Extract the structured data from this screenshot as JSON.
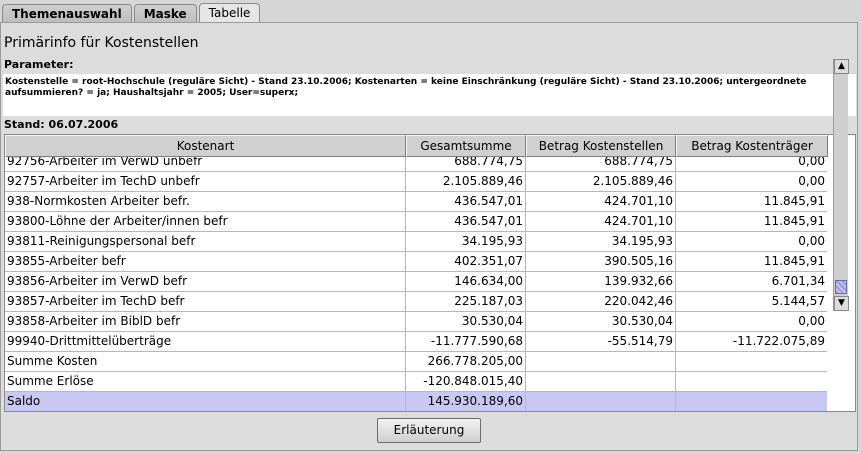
{
  "tabs": [
    {
      "label": "Themenauswahl"
    },
    {
      "label": "Maske"
    },
    {
      "label": "Tabelle"
    }
  ],
  "title": "Primärinfo für Kostenstellen",
  "parameters": {
    "label": "Parameter:",
    "text": "Kostenstelle = root-Hochschule (reguläre Sicht) - Stand 23.10.2006; Kostenarten = keine Einschränkung (reguläre Sicht) - Stand 23.10.2006; untergeordnete aufsummieren? = ja; Haushaltsjahr = 2005; User=superx;"
  },
  "stand": "Stand: 06.07.2006",
  "table": {
    "columns": [
      "Kostenart",
      "Gesamtsumme",
      "Betrag Kostenstellen",
      "Betrag Kostenträger"
    ],
    "rows": [
      [
        "92756-Arbeiter im VerwD unbefr",
        "688.774,75",
        "688.774,75",
        "0,00"
      ],
      [
        "92757-Arbeiter im TechD unbefr",
        "2.105.889,46",
        "2.105.889,46",
        "0,00"
      ],
      [
        "938-Normkosten Arbeiter befr.",
        "436.547,01",
        "424.701,10",
        "11.845,91"
      ],
      [
        "93800-Löhne der Arbeiter/innen befr",
        "436.547,01",
        "424.701,10",
        "11.845,91"
      ],
      [
        "93811-Reinigungspersonal befr",
        "34.195,93",
        "34.195,93",
        "0,00"
      ],
      [
        "93855-Arbeiter befr",
        "402.351,07",
        "390.505,16",
        "11.845,91"
      ],
      [
        "93856-Arbeiter im VerwD befr",
        "146.634,00",
        "139.932,66",
        "6.701,34"
      ],
      [
        "93857-Arbeiter im TechD befr",
        "225.187,03",
        "220.042,46",
        "5.144,57"
      ],
      [
        "93858-Arbeiter im BiblD befr",
        "30.530,04",
        "30.530,04",
        "0,00"
      ],
      [
        "99940-Drittmittelüberträge",
        "-11.777.590,68",
        "-55.514,79",
        "-11.722.075,89"
      ],
      [
        "Summe Kosten",
        "266.778.205,00",
        "",
        ""
      ],
      [
        "Summe Erlöse",
        "-120.848.015,40",
        "",
        ""
      ],
      [
        "Saldo",
        "145.930.189,60",
        "",
        ""
      ]
    ],
    "selected_row": "Saldo"
  },
  "scrollbar": {
    "up_icon": "arrow-up-icon",
    "down_icon": "arrow-down-icon",
    "position": 0.95
  },
  "button": {
    "label": "Erläuterung"
  },
  "colors": {
    "selection": "#c8c8f4",
    "background": "#d6d6d6"
  }
}
